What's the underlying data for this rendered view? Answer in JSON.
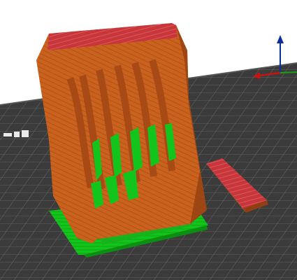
{
  "app": {
    "view_label": "",
    "colors": {
      "background": "#ffffff",
      "bed": "#3b3b3b",
      "bed_grid": "#7a7a7a",
      "model_orange": "#c9621e",
      "model_dark": "#8f3f12",
      "model_red": "#c8353b",
      "support_green": "#12c41c",
      "axis_blue": "#0b2f9f",
      "axis_red": "#cc1111",
      "axis_green": "#15a315"
    },
    "icons": {
      "axes_gizmo": "axes-gizmo-icon",
      "bed_mark": "bed-logo-icon"
    }
  }
}
